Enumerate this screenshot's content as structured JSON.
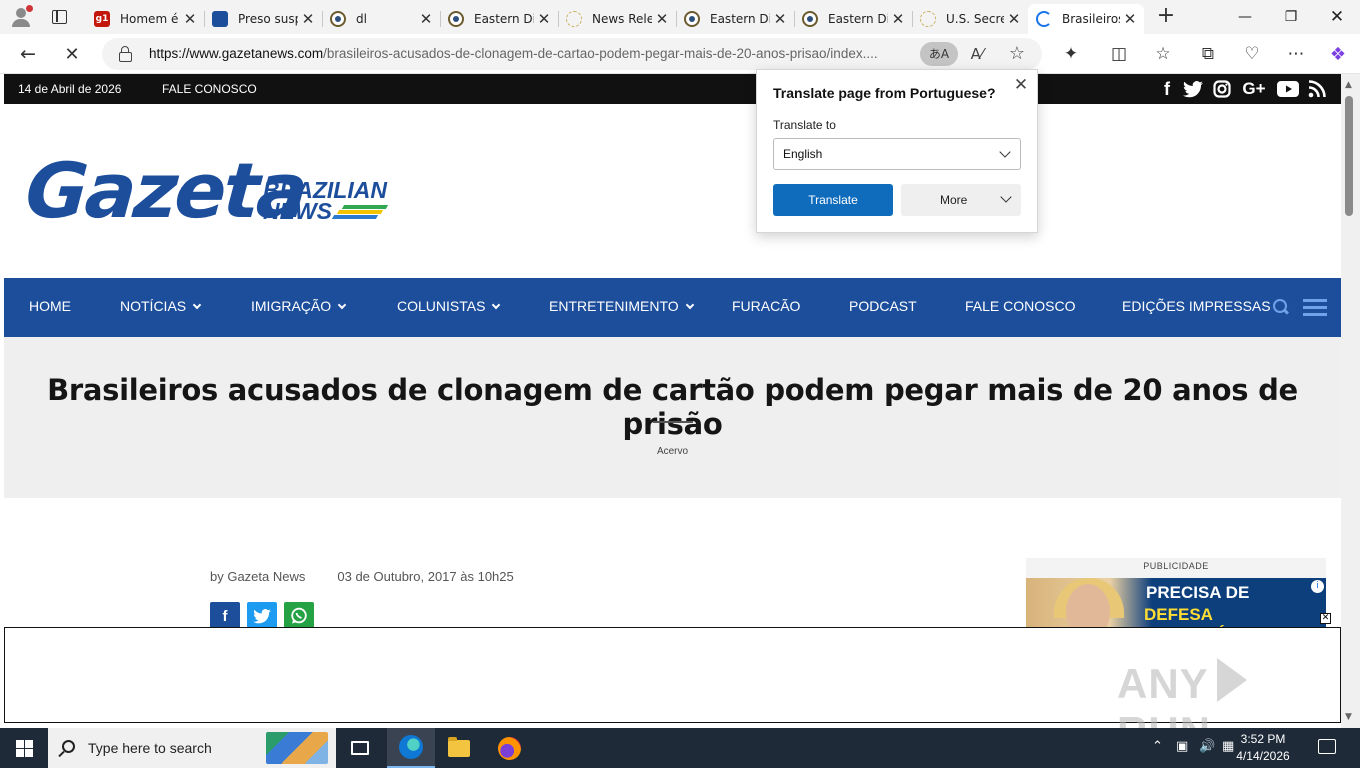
{
  "browser": {
    "tabs": [
      {
        "label": "Homem é",
        "favicon": "g1-icon"
      },
      {
        "label": "Preso susp",
        "favicon": "news-icon"
      },
      {
        "label": "dl",
        "favicon": "seal-icon"
      },
      {
        "label": "Eastern Di",
        "favicon": "seal-icon"
      },
      {
        "label": "News Rele",
        "favicon": "seal-outline-icon"
      },
      {
        "label": "Eastern Di",
        "favicon": "seal-icon"
      },
      {
        "label": "Eastern Di",
        "favicon": "seal-icon"
      },
      {
        "label": "U.S. Secret",
        "favicon": "seal-outline-icon"
      },
      {
        "label": "Brasileiros",
        "favicon": "loading-icon"
      }
    ],
    "url_domain": "https://www.gazetanews.com",
    "url_path": "/brasileiros-acusados-de-clonagem-de-cartao-podem-pegar-mais-de-20-anos-prisao/index....",
    "translate_icon_text": "あA"
  },
  "site": {
    "date": "14 de Abril de 2026",
    "contact_link": "FALE CONOSCO",
    "logo_main": "Gazeta",
    "logo_line1": "BRAZILIAN",
    "logo_line2": "NEWS",
    "nav": [
      {
        "label": "HOME",
        "dropdown": false
      },
      {
        "label": "NOTÍCIAS",
        "dropdown": true
      },
      {
        "label": "IMIGRAÇÃO",
        "dropdown": true
      },
      {
        "label": "COLUNISTAS",
        "dropdown": true
      },
      {
        "label": "ENTRETENIMENTO",
        "dropdown": true
      },
      {
        "label": "FURACÃO",
        "dropdown": false
      },
      {
        "label": "PODCAST",
        "dropdown": false
      },
      {
        "label": "FALE CONOSCO",
        "dropdown": false
      },
      {
        "label": "EDIÇÕES IMPRESSAS",
        "dropdown": false
      }
    ],
    "social": [
      "facebook-icon",
      "twitter-icon",
      "instagram-icon",
      "google-plus-icon",
      "youtube-icon",
      "rss-icon"
    ]
  },
  "article": {
    "title": "Brasileiros acusados de clonagem de cartão podem pegar mais de 20 anos de prisão",
    "category": "Acervo",
    "author": "by Gazeta News",
    "date": "03 de Outubro, 2017 às 10h25"
  },
  "ad": {
    "label": "PUBLICIDADE",
    "line1": "PRECISA DE",
    "line2": "DEFESA IMIGRATÓRIA?"
  },
  "watermark": {
    "left": "ANY",
    "right": "RUN"
  },
  "translate_popup": {
    "title": "Translate page from Portuguese?",
    "translate_to_label": "Translate to",
    "selected_language": "English",
    "translate_button": "Translate",
    "more_button": "More"
  },
  "taskbar": {
    "search_placeholder": "Type here to search",
    "time": "3:52 PM",
    "date": "4/14/2026"
  },
  "colors": {
    "brand_blue": "#1c4e9c",
    "translate_blue": "#0f6cbd",
    "taskbar": "#1f2a38"
  }
}
